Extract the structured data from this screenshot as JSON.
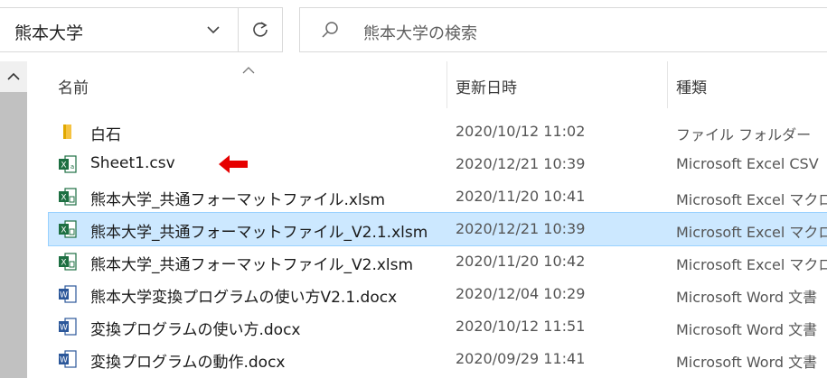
{
  "address": {
    "path": "熊本大学"
  },
  "search": {
    "placeholder": "熊本大学の検索"
  },
  "columns": {
    "name": "名前",
    "date": "更新日時",
    "type": "種類"
  },
  "files": [
    {
      "name": "白石",
      "date": "2020/10/12 11:02",
      "type": "ファイル フォルダー",
      "icon": "folder-icon"
    },
    {
      "name": "Sheet1.csv",
      "date": "2020/12/21 10:39",
      "type": "Microsoft Excel CSV",
      "icon": "excel-csv-icon"
    },
    {
      "name": "熊本大学_共通フォーマットファイル.xlsm",
      "date": "2020/11/20 10:41",
      "type": "Microsoft Excel マクロ",
      "icon": "excel-macro-icon"
    },
    {
      "name": "熊本大学_共通フォーマットファイル_V2.1.xlsm",
      "date": "2020/12/21 10:39",
      "type": "Microsoft Excel マクロ",
      "icon": "excel-macro-icon",
      "selected": true
    },
    {
      "name": "熊本大学_共通フォーマットファイル_V2.xlsm",
      "date": "2020/11/20 10:42",
      "type": "Microsoft Excel マクロ",
      "icon": "excel-macro-icon"
    },
    {
      "name": "熊本大学変換プログラムの使い方V2.1.docx",
      "date": "2020/12/04 10:29",
      "type": "Microsoft Word 文書",
      "icon": "word-icon"
    },
    {
      "name": "変換プログラムの使い方.docx",
      "date": "2020/10/12 11:51",
      "type": "Microsoft Word 文書",
      "icon": "word-icon"
    },
    {
      "name": "変換プログラムの動作.docx",
      "date": "2020/09/29 11:41",
      "type": "Microsoft Word 文書",
      "icon": "word-icon"
    }
  ],
  "colors": {
    "selection": "#cce8ff",
    "excel": "#1d6f42",
    "word": "#2b579a",
    "folder": "#f5c342",
    "arrow": "#e60000"
  }
}
